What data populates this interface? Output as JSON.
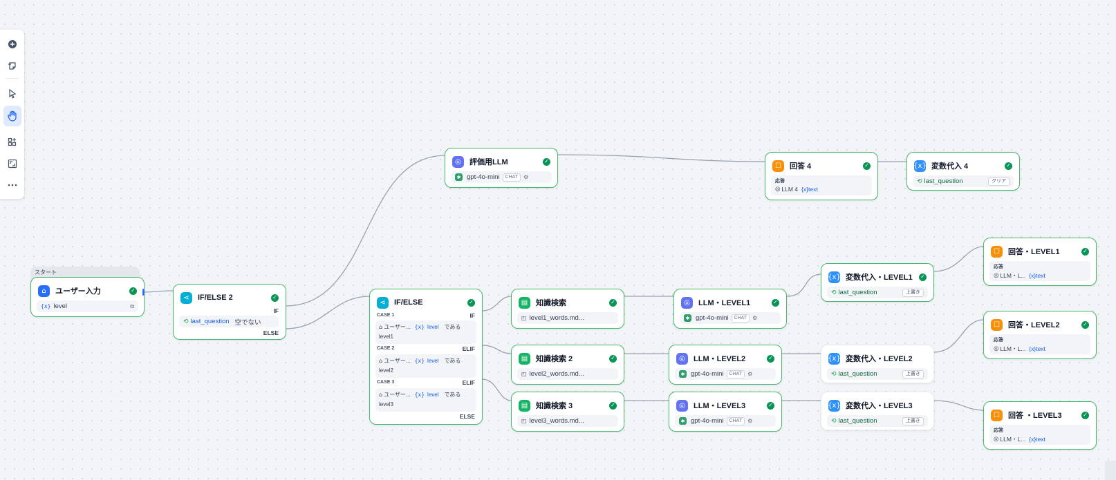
{
  "toolbar": {
    "items": [
      {
        "name": "add-node",
        "icon": "plus-circle-icon"
      },
      {
        "name": "add-note",
        "icon": "note-icon"
      },
      {
        "name": "pointer",
        "icon": "pointer-icon"
      },
      {
        "name": "hand",
        "icon": "hand-icon",
        "active": true
      },
      {
        "name": "organize",
        "icon": "grid-icon"
      },
      {
        "name": "fit-view",
        "icon": "fit-icon"
      },
      {
        "name": "more",
        "icon": "more-icon"
      }
    ]
  },
  "colors": {
    "edge": "#98a2b3",
    "node_border_ok": "#47b86d",
    "check": "#079455",
    "accent": "#155eef"
  },
  "start": {
    "tab_label": "スタート",
    "title": "ユーザー入力",
    "variable": "level"
  },
  "ifelse2": {
    "title": "IF/ELSE 2",
    "if_label": "IF",
    "condition_var": "last_question",
    "condition_op": "空でない",
    "else_label": "ELSE"
  },
  "ifelse": {
    "title": "IF/ELSE",
    "cases": [
      {
        "case": "CASE 1",
        "branch": "IF",
        "source": "ユーザー...",
        "var": "level",
        "op": "である",
        "value": "level1"
      },
      {
        "case": "CASE 2",
        "branch": "ELIF",
        "source": "ユーザー...",
        "var": "level",
        "op": "である",
        "value": "level2"
      },
      {
        "case": "CASE 3",
        "branch": "ELIF",
        "source": "ユーザー...",
        "var": "level",
        "op": "である",
        "value": "level3"
      }
    ],
    "else_label": "ELSE"
  },
  "eval_llm": {
    "title": "評価用LLM",
    "model": "gpt-4o-mini",
    "mode": "CHAT"
  },
  "answer4": {
    "title": "回答 4",
    "resp_label": "応答",
    "source": "LLM 4",
    "var": "text"
  },
  "assign4": {
    "title": "変数代入 4",
    "var": "last_question",
    "action": "クリア"
  },
  "knowledge1": {
    "title": "知識検索",
    "dataset": "level1_words.md..."
  },
  "knowledge2": {
    "title": "知識検索 2",
    "dataset": "level2_words.md..."
  },
  "knowledge3": {
    "title": "知識検索 3",
    "dataset": "level3_words.md..."
  },
  "llm1": {
    "title": "LLM・LEVEL1",
    "model": "gpt-4o-mini",
    "mode": "CHAT"
  },
  "llm2": {
    "title": "LLM・LEVEL2",
    "model": "gpt-4o-mini",
    "mode": "CHAT"
  },
  "llm3": {
    "title": "LLM・LEVEL3",
    "model": "gpt-4o-mini",
    "mode": "CHAT"
  },
  "assign_l1": {
    "title": "変数代入・LEVEL1",
    "var": "last_question",
    "action": "上書き"
  },
  "assign_l2": {
    "title": "変数代入・LEVEL2",
    "var": "last_question",
    "action": "上書き"
  },
  "assign_l3": {
    "title": "変数代入・LEVEL3",
    "var": "last_question",
    "action": "上書き"
  },
  "answer_l1": {
    "title": "回答・LEVEL1",
    "resp_label": "応答",
    "source": "LLM・L...",
    "var": "text"
  },
  "answer_l2": {
    "title": "回答・LEVEL2",
    "resp_label": "応答",
    "source": "LLM・L...",
    "var": "text"
  },
  "answer_l3": {
    "title": "回答 ・LEVEL3",
    "resp_label": "応答",
    "source": "LLM・L...",
    "var": "text"
  }
}
